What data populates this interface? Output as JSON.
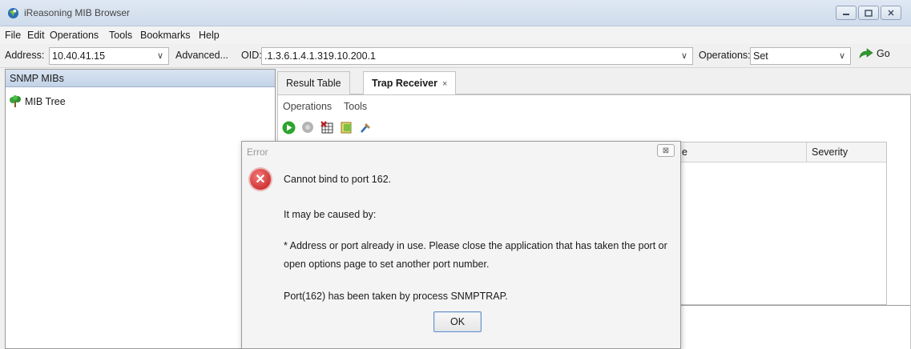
{
  "window": {
    "title": "iReasoning MIB Browser",
    "controls": [
      "minimize",
      "maximize",
      "close"
    ]
  },
  "menubar": {
    "items": [
      "File",
      "Edit",
      "Operations",
      "Tools",
      "Bookmarks",
      "Help"
    ]
  },
  "address_bar": {
    "address_label": "Address:",
    "address_value": "10.40.41.15",
    "advanced_label": "Advanced...",
    "oid_label": "OID:",
    "oid_value": ".1.3.6.1.4.1.319.10.200.1",
    "operations_label": "Operations:",
    "operations_value": "Set",
    "go_label": "Go"
  },
  "left_panel": {
    "header": "SNMP MIBs",
    "tree_root": "MIB Tree"
  },
  "tabs": [
    {
      "label": "Result Table",
      "active": false
    },
    {
      "label": "Trap Receiver",
      "active": true,
      "closable": true,
      "close_glyph": "×"
    }
  ],
  "trap_receiver": {
    "menu": [
      "Operations",
      "Tools"
    ],
    "toolbar_icons": [
      "start-icon",
      "stop-icon",
      "delete-all-icon",
      "save-icon",
      "settings-icon"
    ],
    "columns": {
      "partial": "e",
      "severity": "Severity"
    }
  },
  "dialog": {
    "title": "Error",
    "close_glyph": "⊠",
    "icon": "error-icon",
    "lines": [
      "Cannot bind to port 162.",
      "It may be caused by:",
      "* Address or port already in use. Please close the application that has taken the port or",
      "open options page to set another port number.",
      "Port(162) has been taken by process SNMPTRAP."
    ],
    "ok_label": "OK"
  },
  "colors": {
    "title_bar": "#cfdceb",
    "error_red": "#c01818",
    "go_green": "#2e9a2e"
  }
}
